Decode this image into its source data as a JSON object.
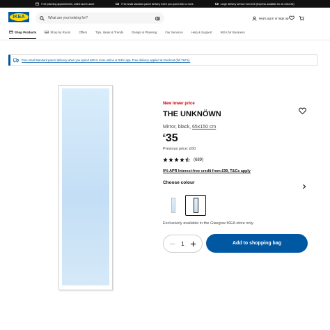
{
  "promo_bar": {
    "items": [
      {
        "icon": "calendar-icon",
        "text": "Free planning appointments, online and in-store"
      },
      {
        "icon": "truck-icon",
        "text": "Free small standard parcel delivery when you spend £60 or more"
      },
      {
        "icon": "truck-icon",
        "text": "Large delivery service from £25 (Express available for an extra £5)"
      }
    ]
  },
  "header": {
    "logo_text": "IKEA",
    "search_placeholder": "What are you looking for?",
    "user_link": "Hej! Log in or sign up",
    "icons": [
      "search-icon",
      "camera-icon",
      "user-icon",
      "heart-icon",
      "cart-icon"
    ]
  },
  "nav": {
    "items": [
      {
        "label": "Shop Products",
        "active": true
      },
      {
        "label": "Shop by Room"
      },
      {
        "label": "Offers"
      },
      {
        "label": "Tips, Ideas & Trends"
      },
      {
        "label": "Design & Planning"
      },
      {
        "label": "Our Services"
      },
      {
        "label": "Help & Support"
      },
      {
        "label": "IKEA for Business"
      }
    ]
  },
  "notice": {
    "text": "Free small standard parcel delivery when you spend £60 or more online or IKEA app. Free delivery applied at checkout (full T&Cs)."
  },
  "product": {
    "badge": "New lower price",
    "name": "THE UNKNÖWN",
    "subtitle": "Mirror, black,",
    "size": "65x150 cm",
    "currency": "£",
    "price": "35",
    "previous_price": "Previous price: £60",
    "rating": 4.5,
    "review_count": "(689)",
    "finance": "0% APR Interest-free credit from £99, T&Cs apply",
    "colour_title": "Choose colour",
    "swatches": [
      {
        "name": "white",
        "selected": false
      },
      {
        "name": "black",
        "selected": true
      }
    ],
    "exclusive": "Exclusively available in the Glasgow IKEA store only.",
    "quantity": "1",
    "add_to_bag": "Add to shopping bag"
  },
  "colors": {
    "brand_blue": "#0058a3",
    "brand_yellow": "#ffdb00",
    "sale_red": "#cc0008",
    "promo_bar_bg": "#111111"
  }
}
